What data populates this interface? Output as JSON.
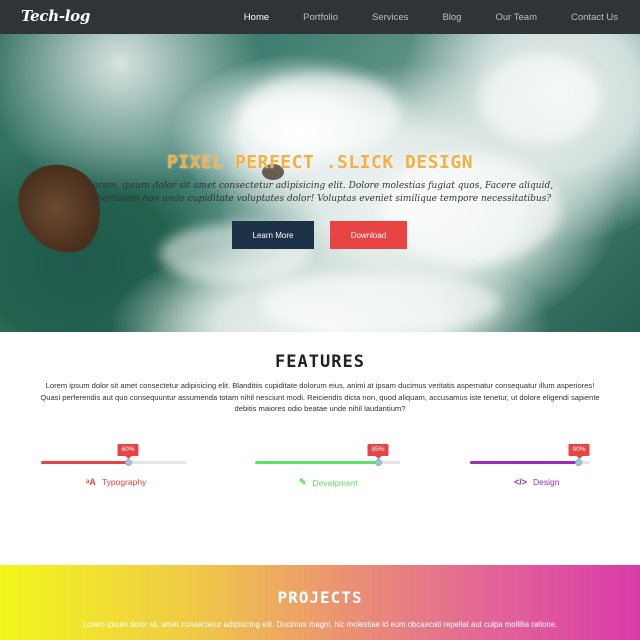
{
  "nav": {
    "brand": "Tech-log",
    "links": [
      {
        "label": "Home",
        "active": true
      },
      {
        "label": "Portfolio",
        "active": false
      },
      {
        "label": "Services",
        "active": false
      },
      {
        "label": "Blog",
        "active": false
      },
      {
        "label": "Our Team",
        "active": false
      },
      {
        "label": "Contact Us",
        "active": false
      }
    ]
  },
  "hero": {
    "title": "PIXEL PERFECT .SLICK DESIGN",
    "subtitle": "Lorem, ipsum dolor sit amet consectetur adipisicing elit. Dolore molestias fugiat quos, Facere aliquid, laboriosam non unde cupiditate voluptates dolor! Voluptas eveniet similique tempore necessitatibus?",
    "learn_label": "Learn More",
    "download_label": "Download"
  },
  "features": {
    "title": "FEATURES",
    "text": "Lorem ipsum dolor sit amet consectetur adipisicing elit. Blanditiis cupiditate dolorum eius, animi at ipsam ducimus veritatis aspernatur consequatur illum asperiores! Quasi perferendis aut quo consequuntur assumenda totam nihil nesciunt modi. Reiciendis dicta non, quod aliquam, accusamus iste tenetur, ut dolore eligendi sapiente debitis maiores odio beatae unde nihil laudantium?",
    "skills": [
      {
        "label": "Typography",
        "percent_text": "60%",
        "value": 60,
        "color": "#e94444",
        "label_color": "#e94444",
        "icon": "type-icon"
      },
      {
        "label": "Develpment",
        "percent_text": "85%",
        "value": 85,
        "color": "#5ee26a",
        "label_color": "#5ee26a",
        "icon": "pencil-icon"
      },
      {
        "label": "Design",
        "percent_text": "90%",
        "value": 90,
        "color": "#9b2bb8",
        "label_color": "#9b2bb8",
        "icon": "code-icon"
      }
    ]
  },
  "projects": {
    "title": "PROJECTS",
    "text": "Lorem ipsum dolor sit, amet consectetur adipisicing elit. Ducimus magni, hic molestiae id eum obcaecati repellat aut culpa mollitia ratione."
  }
}
